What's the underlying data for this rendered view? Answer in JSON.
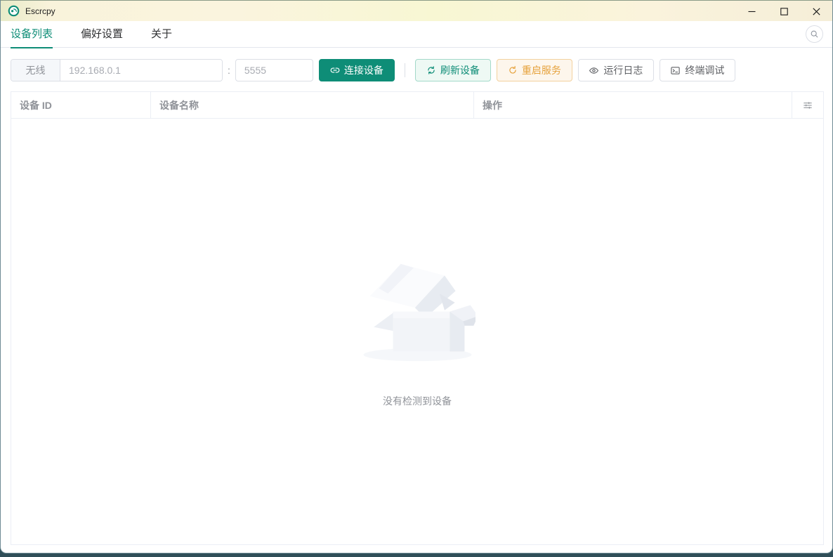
{
  "window": {
    "title": "Escrcpy"
  },
  "icons": {
    "app_logo": "escrcpy-logo",
    "minimize": "minimize-line",
    "maximize": "maximize-square",
    "close": "close-x",
    "search": "magnifier",
    "connect": "connection-link",
    "refresh": "refresh-arrows",
    "restart": "refresh-right-arrow",
    "logs": "eye-view",
    "terminal": "terminal-monitor",
    "column_settings": "sliders-operation",
    "empty_state": "empty-open-box"
  },
  "tabs": [
    {
      "label": "设备列表",
      "active": true
    },
    {
      "label": "偏好设置",
      "active": false
    },
    {
      "label": "关于",
      "active": false
    }
  ],
  "toolbar": {
    "wireless_label": "无线",
    "ip_placeholder": "192.168.0.1",
    "ip_value": "",
    "separator": ":",
    "port_placeholder": "5555",
    "port_value": "",
    "connect_label": "连接设备",
    "refresh_label": "刷新设备",
    "restart_label": "重启服务",
    "logs_label": "运行日志",
    "terminal_label": "终端调试"
  },
  "table": {
    "columns": [
      "设备 ID",
      "设备名称",
      "操作"
    ],
    "rows": [],
    "empty_text": "没有检测到设备"
  },
  "colors": {
    "primary": "#0e8d77",
    "success_bg": "#eef9f4",
    "success_border": "#a3d9c9",
    "warning": "#e6a23c",
    "warning_bg": "#fdf6ec",
    "warning_border": "#f3d19e",
    "titlebar_tint": "#f8f4da",
    "header_text": "#909399",
    "border_light": "#ebeef5"
  }
}
